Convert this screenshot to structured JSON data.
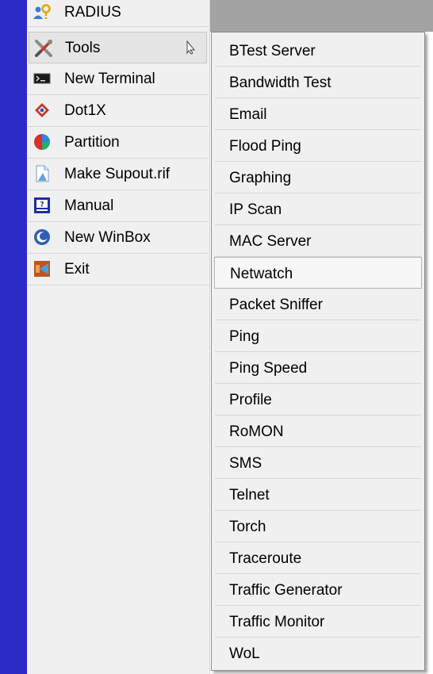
{
  "main_menu": {
    "items": [
      {
        "label": "RADIUS",
        "icon": "radius-icon"
      },
      {
        "label": "Tools",
        "icon": "tools-icon"
      },
      {
        "label": "New Terminal",
        "icon": "terminal-icon"
      },
      {
        "label": "Dot1X",
        "icon": "dot1x-icon"
      },
      {
        "label": "Partition",
        "icon": "partition-icon"
      },
      {
        "label": "Make Supout.rif",
        "icon": "supout-icon"
      },
      {
        "label": "Manual",
        "icon": "manual-icon"
      },
      {
        "label": "New WinBox",
        "icon": "winbox-icon"
      },
      {
        "label": "Exit",
        "icon": "exit-icon"
      }
    ]
  },
  "tools_submenu": {
    "items": [
      "BTest Server",
      "Bandwidth Test",
      "Email",
      "Flood Ping",
      "Graphing",
      "IP Scan",
      "MAC Server",
      "Netwatch",
      "Packet Sniffer",
      "Ping",
      "Ping Speed",
      "Profile",
      "RoMON",
      "SMS",
      "Telnet",
      "Torch",
      "Traceroute",
      "Traffic Generator",
      "Traffic Monitor",
      "WoL"
    ]
  },
  "colors": {
    "sidebar_strip": "#2b2bc7",
    "menu_background": "#f0f0f0",
    "workspace_gray": "#a3a3a3"
  }
}
